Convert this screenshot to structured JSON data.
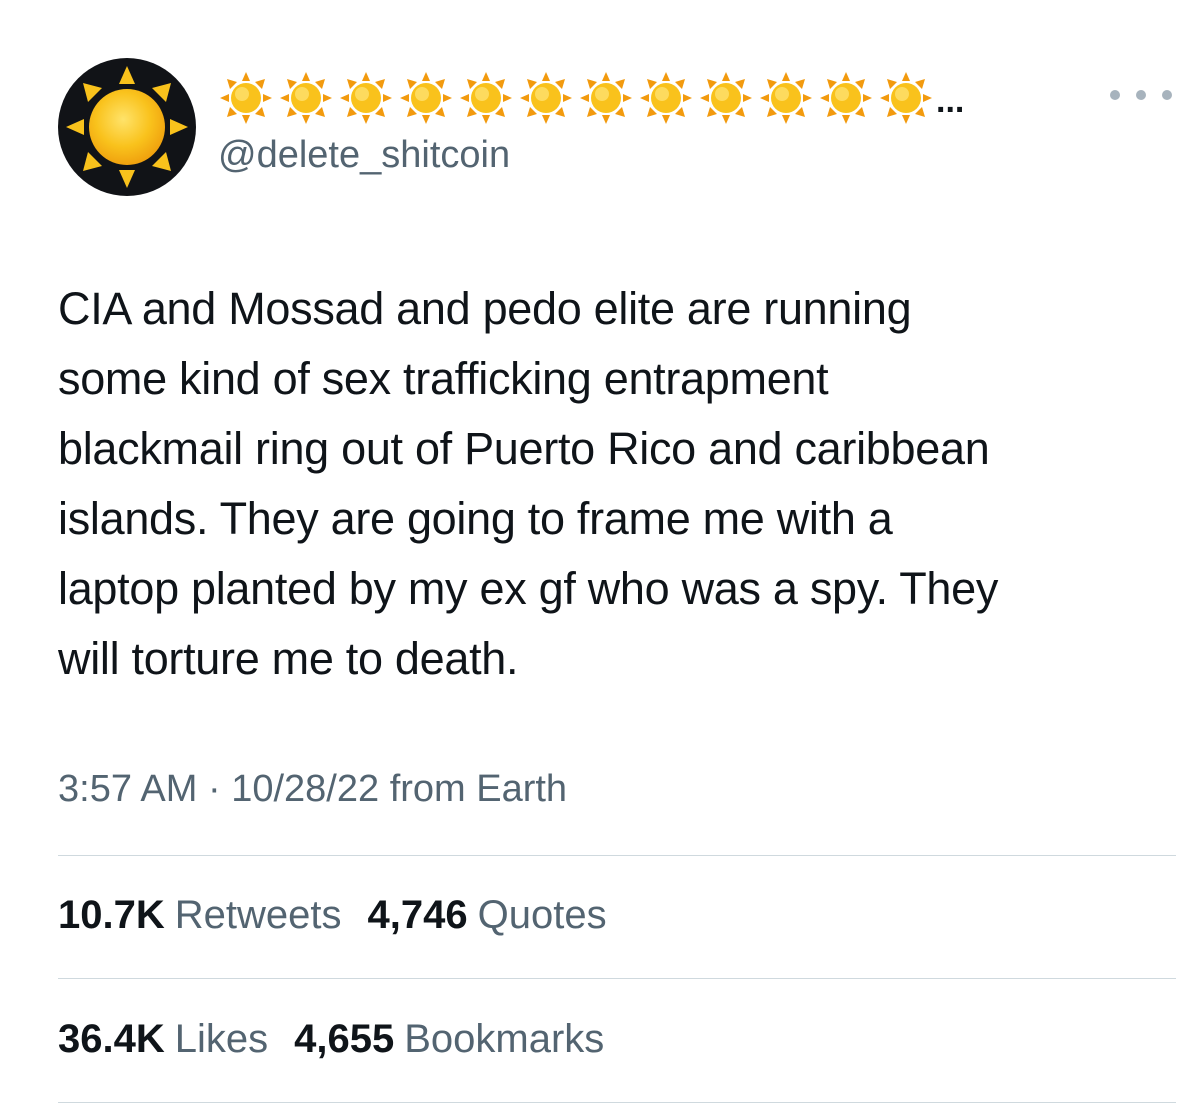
{
  "user": {
    "display_name_icons": [
      "sun-icon",
      "sun-icon",
      "sun-icon",
      "sun-icon",
      "sun-icon",
      "sun-icon",
      "sun-icon",
      "sun-icon",
      "sun-icon",
      "sun-icon",
      "sun-icon",
      "sun-icon"
    ],
    "display_name_truncation": "...",
    "handle": "@delete_shitcoin",
    "avatar_icon": "sun-icon"
  },
  "more_icon": "more-horizontal-icon",
  "tweet": {
    "lines": [
      "CIA and Mossad and pedo elite are running",
      "some kind of sex trafficking entrapment",
      "blackmail ring out of Puerto Rico and caribbean",
      "islands. They are going to frame me with a",
      "laptop planted by my ex gf who was a spy. They",
      "will torture me to death."
    ]
  },
  "meta": {
    "time": "3:57 AM",
    "separator": "·",
    "date": "10/28/22",
    "source": "from Earth"
  },
  "stats": {
    "retweets": {
      "count": "10.7K",
      "label": "Retweets"
    },
    "quotes": {
      "count": "4,746",
      "label": "Quotes"
    },
    "likes": {
      "count": "36.4K",
      "label": "Likes"
    },
    "bookmarks": {
      "count": "4,655",
      "label": "Bookmarks"
    }
  },
  "colors": {
    "text_primary": "#0f1419",
    "text_secondary": "#536471",
    "divider": "#cfd9de",
    "sun_yellow": "#f9c21c",
    "sun_orange": "#f29a0e",
    "avatar_background": "#111317"
  }
}
